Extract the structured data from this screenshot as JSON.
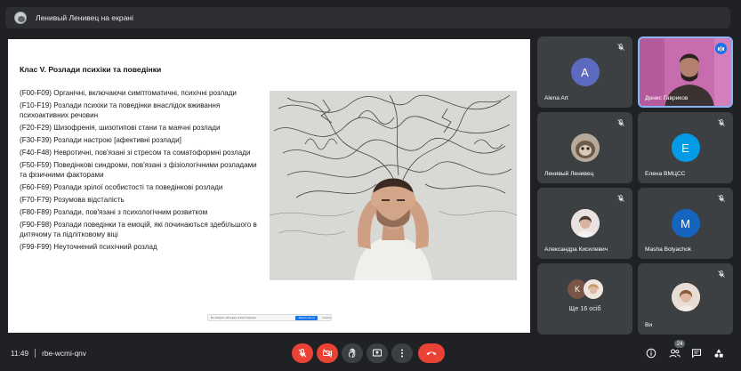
{
  "presenter_bar": {
    "label": "Ленивый Ленивец на екрані"
  },
  "slide": {
    "title": "Клас V. Розлади психіки та поведінки",
    "items": [
      "(F00-F09) Органічні, включаючи симптоматичні, психічні розлади",
      "(F10-F19) Розлади психіки та поведінки внаслідок вживання психоактивних речовин",
      "(F20-F29) Шизофренія, шизотипові стани та маячні розлади",
      "(F30-F39) Розлади настрою [афективні розлади]",
      "(F40-F48) Невротичні, пов'язані зі стресом та соматоформні розлади",
      "(F50-F59) Поведінкові синдроми, пов'язані з фізіологічними розладами та фізичними факторами",
      "(F60-F69) Розлади зрілої особистості та поведінкові розлади",
      "(F70-F79) Розумова відсталість",
      "(F80-F89) Розлади, пов'язані з психологічним розвитком",
      "(F90-F98) Розлади поведінки та емоцій, які починаються здебільшого в дитячому та підлітковому віці",
      "(F99-F99) Неуточнений психічний розлад"
    ],
    "image_icon": "stressed-man-photo",
    "share_notice": {
      "text": "Ви показуєте свій екран та вікно браузера",
      "stop_label": "Закрити доступ",
      "hide_label": "Сховати"
    }
  },
  "participants": [
    {
      "name": "Alena Art",
      "initial": "A",
      "color": "#5c6bc0",
      "mic_muted": true
    },
    {
      "name": "Денис Гавриков",
      "speaking": true
    },
    {
      "name": "Ленивый Ленивец",
      "avatar": "photo",
      "mic_muted": true
    },
    {
      "name": "Елена ВМЦСС",
      "initial": "E",
      "color": "#039be5",
      "mic_muted": true
    },
    {
      "name": "Александра Кисилевич",
      "avatar": "photo",
      "mic_muted": true
    },
    {
      "name": "Masha Bolyachok",
      "initial": "M",
      "color": "#1565c0",
      "mic_muted": true
    },
    {
      "more_label": "Ще 16 осіб",
      "mini_initial": "K",
      "mini_color": "#795548"
    },
    {
      "name": "Ви",
      "avatar": "photo",
      "mic_muted": true
    }
  ],
  "bottom_bar": {
    "time": "11:49",
    "meeting_code": "rbe-wcmi-qnv",
    "people_count": "24",
    "colors": {
      "danger": "#ea4335",
      "control": "#3c4043",
      "accent": "#8ab4f8"
    }
  }
}
